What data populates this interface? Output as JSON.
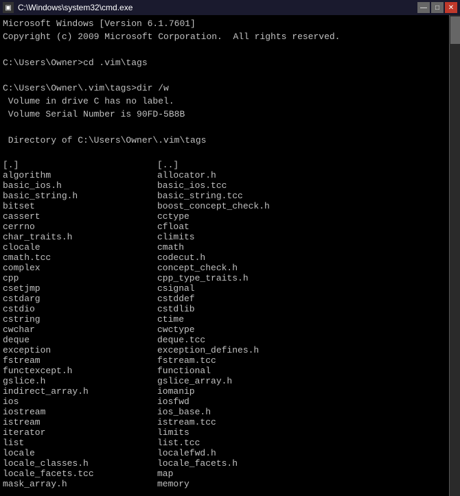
{
  "titlebar": {
    "title": "C:\\Windows\\system32\\cmd.exe",
    "icon": "▣",
    "minimize": "—",
    "maximize": "□",
    "close": "✕"
  },
  "lines": [
    {
      "text": "Microsoft Windows [Version 6.1.7601]"
    },
    {
      "text": "Copyright (c) 2009 Microsoft Corporation.  All rights reserved."
    },
    {
      "text": ""
    },
    {
      "text": "C:\\Users\\Owner>cd .vim\\tags"
    },
    {
      "text": ""
    },
    {
      "text": "C:\\Users\\Owner\\.vim\\tags>dir /w"
    },
    {
      "text": " Volume in drive C has no label."
    },
    {
      "text": " Volume Serial Number is 90FD-5B8B"
    },
    {
      "text": ""
    },
    {
      "text": " Directory of C:\\Users\\Owner\\.vim\\tags"
    },
    {
      "text": ""
    }
  ],
  "filerows": [
    {
      "col1": "[.]",
      "col2": "[..]"
    },
    {
      "col1": "algorithm",
      "col2": "allocator.h"
    },
    {
      "col1": "basic_ios.h",
      "col2": "basic_ios.tcc"
    },
    {
      "col1": "basic_string.h",
      "col2": "basic_string.tcc"
    },
    {
      "col1": "bitset",
      "col2": "boost_concept_check.h"
    },
    {
      "col1": "cassert",
      "col2": "cctype"
    },
    {
      "col1": "cerrno",
      "col2": "cfloat"
    },
    {
      "col1": "char_traits.h",
      "col2": "climits"
    },
    {
      "col1": "clocale",
      "col2": "cmath"
    },
    {
      "col1": "cmath.tcc",
      "col2": "codecut.h"
    },
    {
      "col1": "complex",
      "col2": "concept_check.h"
    },
    {
      "col1": "cpp",
      "col2": "cpp_type_traits.h"
    },
    {
      "col1": "csetjmp",
      "col2": "csignal"
    },
    {
      "col1": "cstdarg",
      "col2": "cstddef"
    },
    {
      "col1": "cstdio",
      "col2": "cstdlib"
    },
    {
      "col1": "cstring",
      "col2": "ctime"
    },
    {
      "col1": "cwchar",
      "col2": "cwctype"
    },
    {
      "col1": "deque",
      "col2": "deque.tcc"
    },
    {
      "col1": "exception",
      "col2": "exception_defines.h"
    },
    {
      "col1": "fstream",
      "col2": "fstream.tcc"
    },
    {
      "col1": "functexcept.h",
      "col2": "functional"
    },
    {
      "col1": "gslice.h",
      "col2": "gslice_array.h"
    },
    {
      "col1": "indirect_array.h",
      "col2": "iomanip"
    },
    {
      "col1": "ios",
      "col2": "iosfwd"
    },
    {
      "col1": "iostream",
      "col2": "ios_base.h"
    },
    {
      "col1": "istream",
      "col2": "istream.tcc"
    },
    {
      "col1": "iterator",
      "col2": "limits"
    },
    {
      "col1": "list",
      "col2": "list.tcc"
    },
    {
      "col1": "locale",
      "col2": "localefwd.h"
    },
    {
      "col1": "locale_classes.h",
      "col2": "locale_facets.h"
    },
    {
      "col1": "locale_facets.tcc",
      "col2": "map"
    },
    {
      "col1": "mask_array.h",
      "col2": "memory"
    }
  ]
}
